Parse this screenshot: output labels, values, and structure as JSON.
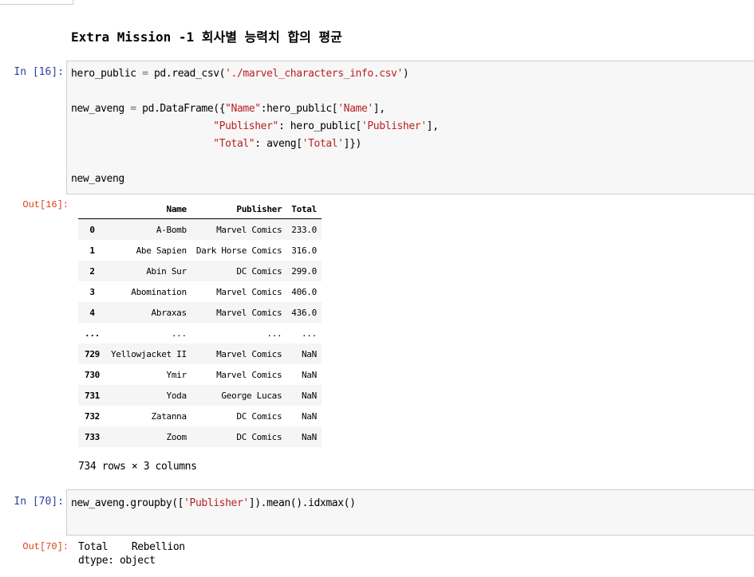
{
  "heading": "Extra Mission -1 회사별 능력치 합의 평균",
  "cell16": {
    "in_prompt": "In [16]:",
    "out_prompt": "Out[16]:",
    "code": {
      "l1": {
        "a": "hero_public ",
        "op": "=",
        "b": " pd.read_csv(",
        "s": "'./marvel_characters_info.csv'",
        "c": ")"
      },
      "l3": {
        "a": "new_aveng ",
        "op": "=",
        "b": " pd.DataFrame({",
        "s1": "\"Name\"",
        "c": ":hero_public[",
        "s2": "'Name'",
        "d": "],"
      },
      "l4": {
        "pad": "                        ",
        "s1": "\"Publisher\"",
        "c": ": hero_public[",
        "s2": "'Publisher'",
        "d": "],"
      },
      "l5": {
        "pad": "                        ",
        "s1": "\"Total\"",
        "c": ": aveng[",
        "s2": "'Total'",
        "d": "]})"
      },
      "l7": "new_aveng"
    },
    "table": {
      "columns": [
        "",
        "Name",
        "Publisher",
        "Total"
      ],
      "rows": [
        [
          "0",
          "A-Bomb",
          "Marvel Comics",
          "233.0"
        ],
        [
          "1",
          "Abe Sapien",
          "Dark Horse Comics",
          "316.0"
        ],
        [
          "2",
          "Abin Sur",
          "DC Comics",
          "299.0"
        ],
        [
          "3",
          "Abomination",
          "Marvel Comics",
          "406.0"
        ],
        [
          "4",
          "Abraxas",
          "Marvel Comics",
          "436.0"
        ],
        [
          "...",
          "...",
          "...",
          "..."
        ],
        [
          "729",
          "Yellowjacket II",
          "Marvel Comics",
          "NaN"
        ],
        [
          "730",
          "Ymir",
          "Marvel Comics",
          "NaN"
        ],
        [
          "731",
          "Yoda",
          "George Lucas",
          "NaN"
        ],
        [
          "732",
          "Zatanna",
          "DC Comics",
          "NaN"
        ],
        [
          "733",
          "Zoom",
          "DC Comics",
          "NaN"
        ]
      ],
      "summary": "734 rows × 3 columns"
    }
  },
  "cell70": {
    "in_prompt": "In [70]:",
    "out_prompt": "Out[70]:",
    "code": {
      "a": "new_aveng.groupby([",
      "s": "'Publisher'",
      "b": "]).mean().idxmax()"
    },
    "output_line1": "Total    Rebellion",
    "output_line2": "dtype: object"
  },
  "colors": {
    "in_prompt": "#303f9f",
    "out_prompt": "#d84315",
    "string": "#ba2121",
    "code_bg": "#f7f7f7",
    "border": "#cfcfcf"
  }
}
